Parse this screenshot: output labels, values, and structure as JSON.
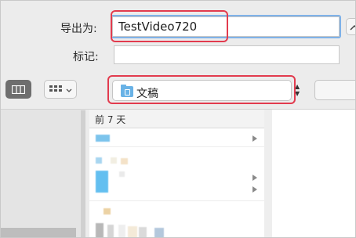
{
  "form": {
    "export_as_label": "导出为:",
    "filename": "TestVideo720",
    "tags_label": "标记:",
    "tags_value": ""
  },
  "toolbar": {
    "view_column_icon": "column-view-icon",
    "view_grid_icon": "grid-view-icon",
    "location_icon": "folder-icon",
    "location": "文稿"
  },
  "browser": {
    "section_header": "前 7 天"
  },
  "colors": {
    "highlight": "#e23b4e",
    "focus": "#7fb2e8",
    "folder": "#69b2e6"
  }
}
